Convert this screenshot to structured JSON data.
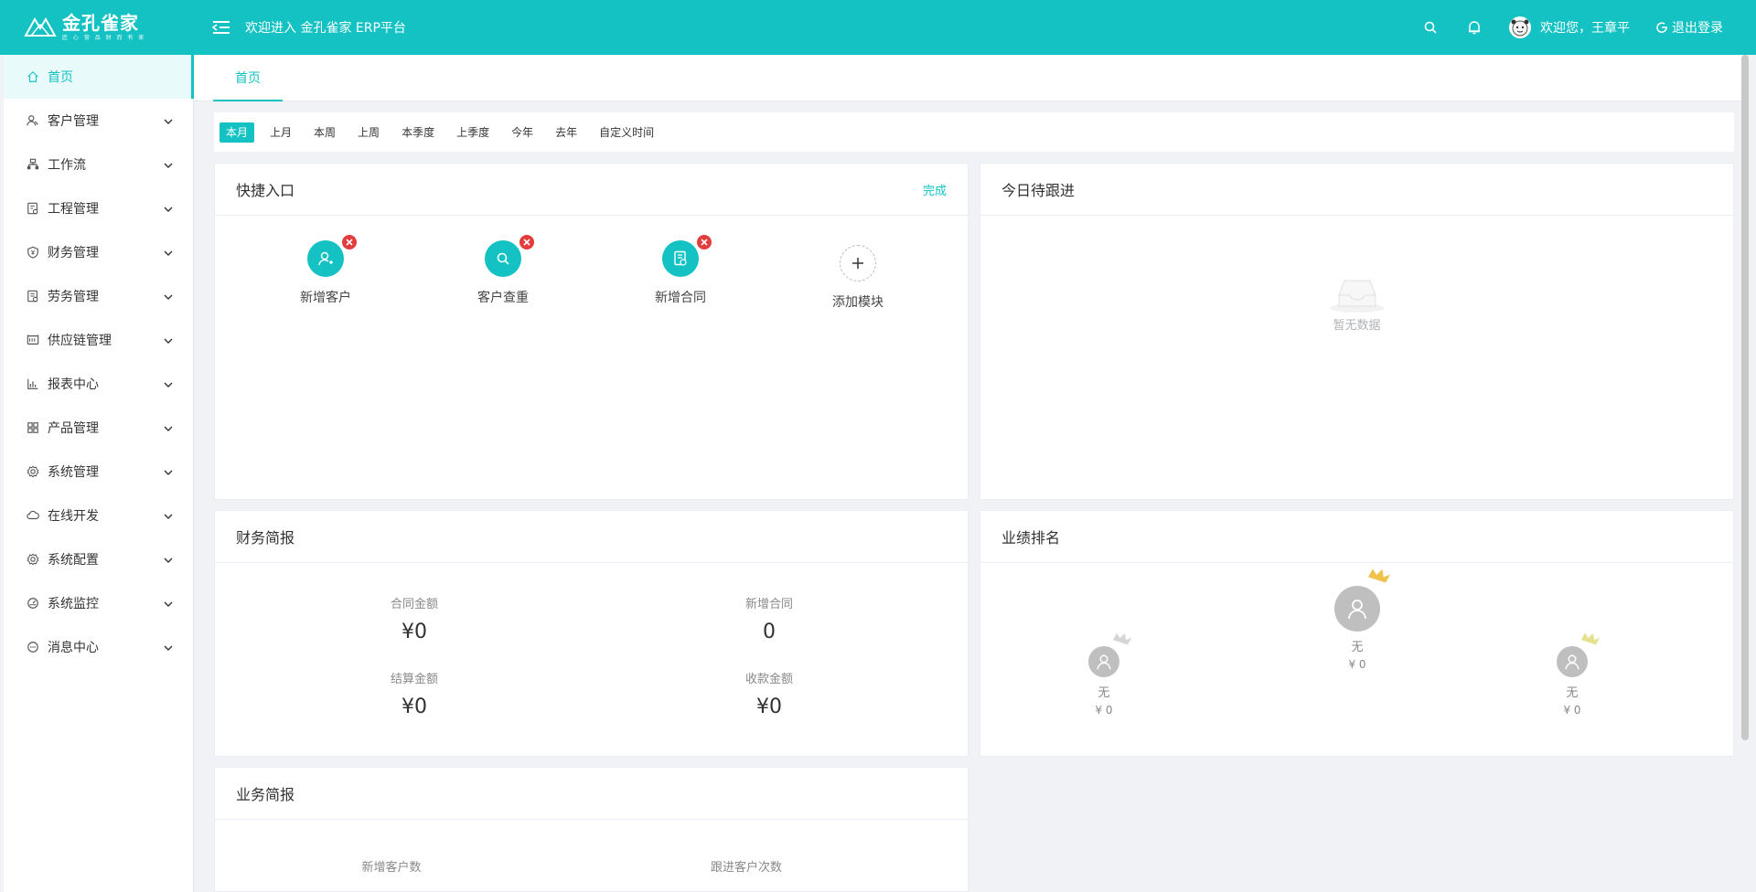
{
  "header": {
    "logo_name": "金孔雀家",
    "logo_sub": "匠 心 营 品   财 而 有 家",
    "welcome": "欢迎进入 金孔雀家 ERP平台",
    "user_greeting": "欢迎您，王章平",
    "logout": "退出登录"
  },
  "sidebar": {
    "items": [
      {
        "label": "首页",
        "icon": "home-icon",
        "active": true
      },
      {
        "label": "客户管理",
        "icon": "customer-icon"
      },
      {
        "label": "工作流",
        "icon": "workflow-icon"
      },
      {
        "label": "工程管理",
        "icon": "project-icon"
      },
      {
        "label": "财务管理",
        "icon": "finance-icon"
      },
      {
        "label": "劳务管理",
        "icon": "labor-icon"
      },
      {
        "label": "供应链管理",
        "icon": "supply-chain-icon"
      },
      {
        "label": "报表中心",
        "icon": "report-icon"
      },
      {
        "label": "产品管理",
        "icon": "product-icon"
      },
      {
        "label": "系统管理",
        "icon": "settings-icon"
      },
      {
        "label": "在线开发",
        "icon": "cloud-icon"
      },
      {
        "label": "系统配置",
        "icon": "config-icon"
      },
      {
        "label": "系统监控",
        "icon": "monitor-icon"
      },
      {
        "label": "消息中心",
        "icon": "message-icon"
      }
    ]
  },
  "tabs": [
    {
      "label": "首页"
    }
  ],
  "filters": [
    "本月",
    "上月",
    "本周",
    "上周",
    "本季度",
    "上季度",
    "今年",
    "去年",
    "自定义时间"
  ],
  "quick": {
    "title": "快捷入口",
    "done": "完成",
    "items": [
      {
        "label": "新增客户",
        "icon": "add-user-icon"
      },
      {
        "label": "客户查重",
        "icon": "search-icon"
      },
      {
        "label": "新增合同",
        "icon": "contract-icon"
      }
    ],
    "add_label": "添加模块"
  },
  "today": {
    "title": "今日待跟进",
    "empty": "暂无数据"
  },
  "finance": {
    "title": "财务简报",
    "stats": [
      {
        "label": "合同金额",
        "value": "¥0"
      },
      {
        "label": "新增合同",
        "value": "0"
      },
      {
        "label": "结算金额",
        "value": "¥0"
      },
      {
        "label": "收款金额",
        "value": "¥0"
      }
    ]
  },
  "ranking": {
    "title": "业绩排名",
    "first": {
      "name": "无",
      "value": "¥ 0"
    },
    "second": {
      "name": "无",
      "value": "¥ 0"
    },
    "third": {
      "name": "无",
      "value": "¥ 0"
    }
  },
  "business": {
    "title": "业务简报",
    "stats": [
      {
        "label": "新增客户数"
      },
      {
        "label": "跟进客户次数"
      }
    ]
  },
  "colors": {
    "accent": "#14c2c3",
    "danger": "#e23c3c",
    "gold": "#f0c14b"
  }
}
